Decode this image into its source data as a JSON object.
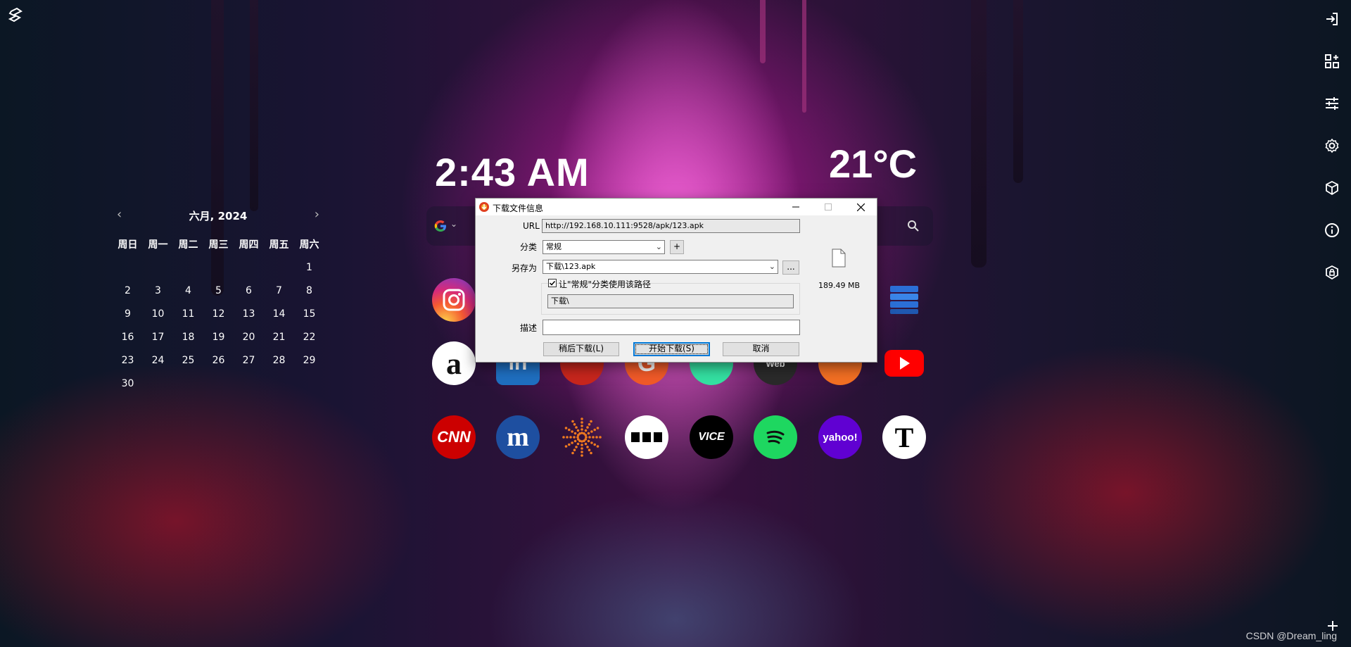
{
  "clock": {
    "time": "2:43 AM"
  },
  "weather": {
    "temperature": "21°C"
  },
  "calendar": {
    "title": "六月, 2024",
    "prev_icon": "chevron-left",
    "next_icon": "chevron-right",
    "weekdays": [
      "周日",
      "周一",
      "周二",
      "周三",
      "周四",
      "周五",
      "周六"
    ],
    "days": [
      "",
      "",
      "",
      "",
      "",
      "",
      "1",
      "2",
      "3",
      "4",
      "5",
      "6",
      "7",
      "8",
      "9",
      "10",
      "11",
      "12",
      "13",
      "14",
      "15",
      "16",
      "17",
      "18",
      "19",
      "20",
      "21",
      "22",
      "23",
      "24",
      "25",
      "26",
      "27",
      "28",
      "29",
      "30",
      "",
      "",
      "",
      "",
      "",
      ""
    ]
  },
  "search": {
    "engine_icon": "google-icon",
    "search_icon": "search-icon"
  },
  "shortcuts": {
    "row1": [
      "instagram-icon",
      "stack-icon"
    ],
    "row2": [
      {
        "icon": "amazon-icon",
        "label": "a"
      },
      {
        "icon": "linkedin-icon",
        "label": "in"
      },
      {
        "icon": "pinterest-icon",
        "label": ""
      },
      {
        "icon": "g-icon",
        "label": "G"
      },
      {
        "icon": "tripadvisor-icon",
        "label": ""
      },
      {
        "icon": "imdb-icon",
        "label": "Web"
      },
      {
        "icon": "soundcloud-icon",
        "label": ""
      },
      {
        "icon": "youtube-icon",
        "label": ""
      }
    ],
    "row3": [
      {
        "icon": "cnn-icon",
        "label": "CNN"
      },
      {
        "icon": "m-icon",
        "label": "m"
      },
      {
        "icon": "dots-icon",
        "label": ""
      },
      {
        "icon": "more-icon",
        "label": ""
      },
      {
        "icon": "vice-icon",
        "label": "VICE"
      },
      {
        "icon": "spotify-icon",
        "label": ""
      },
      {
        "icon": "yahoo-icon",
        "label": "yahoo!"
      },
      {
        "icon": "nyt-icon",
        "label": "T"
      }
    ]
  },
  "rail": [
    "login-icon",
    "widgets-icon",
    "sliders-icon",
    "gear-icon",
    "box-icon",
    "info-icon",
    "lock-icon"
  ],
  "dialog": {
    "title": "下载文件信息",
    "url_label": "URL",
    "url_value": "http://192.168.10.111:9528/apk/123.apk",
    "category_label": "分类",
    "category_value": "常规",
    "add_label": "+",
    "saveas_label": "另存为",
    "saveas_value": "下载\\123.apk",
    "browse_label": "...",
    "remember_label": "让\"常规\"分类使用该路径",
    "remember_checked": true,
    "path_value": "下载\\",
    "desc_label": "描述",
    "desc_value": "",
    "file_size": "189.49 MB",
    "later_button": "稍后下载(L)",
    "start_button": "开始下载(S)",
    "cancel_button": "取消"
  },
  "watermark": "CSDN @Dream_ling"
}
